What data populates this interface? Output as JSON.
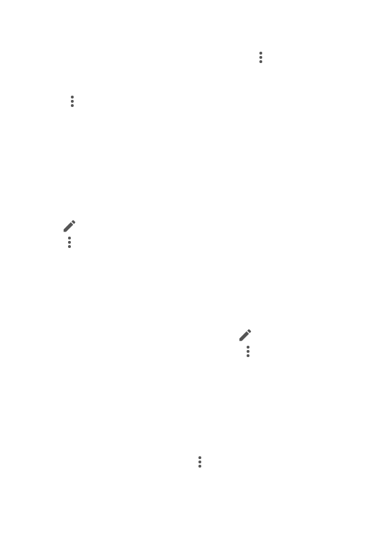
{
  "colors": {
    "background": "#ffffff",
    "icon": "#555555"
  },
  "icons": [
    "more-vert-icon",
    "more-vert-icon",
    "edit-pencil-icon",
    "more-vert-icon",
    "edit-pencil-icon",
    "more-vert-icon",
    "more-vert-icon"
  ]
}
